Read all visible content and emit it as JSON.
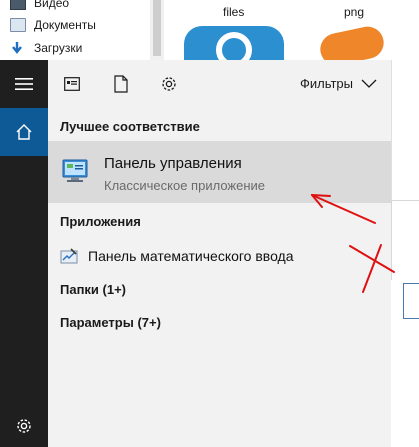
{
  "explorer": {
    "nav_items": [
      "Видео",
      "Документы",
      "Загрузки"
    ],
    "files": [
      "files",
      "png"
    ]
  },
  "search": {
    "filters_label": "Фильтры",
    "best_match_title": "Лучшее соответствие",
    "best_match": {
      "name": "Панель управления",
      "type": "Классическое приложение"
    },
    "apps_title": "Приложения",
    "apps": [
      {
        "name": "Панель математического ввода"
      }
    ],
    "folders_label": "Папки (1+)",
    "params_label": "Параметры (7+)"
  },
  "colors": {
    "rail": "#1f1f1f",
    "home_accent": "#0e5a96",
    "panel": "#f2f2f2",
    "highlight": "#dadada",
    "annotation": "#e01010"
  },
  "icons": [
    "hamburger-icon",
    "home-icon",
    "gear-icon",
    "apps-view-icon",
    "document-icon",
    "chevron-down-icon",
    "control-panel-icon",
    "math-input-icon"
  ]
}
